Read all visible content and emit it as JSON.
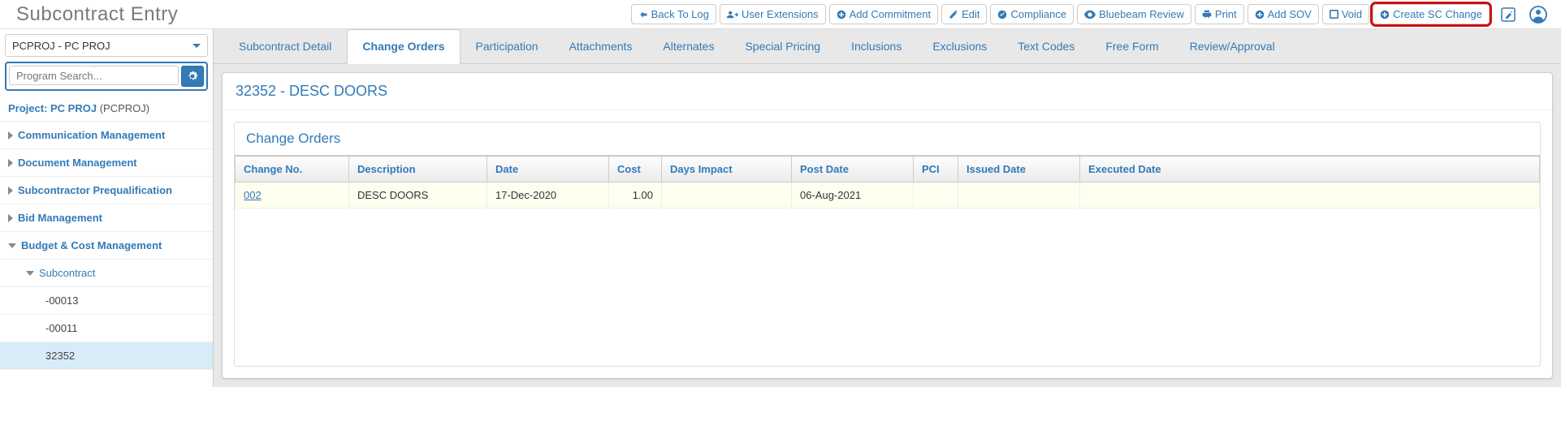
{
  "header": {
    "title": "Subcontract Entry",
    "buttons": {
      "back_to_log": "Back To Log",
      "user_extensions": "User Extensions",
      "add_commitment": "Add Commitment",
      "edit": "Edit",
      "compliance": "Compliance",
      "bluebeam_review": "Bluebeam Review",
      "print": "Print",
      "add_sov": "Add SOV",
      "void": "Void",
      "create_sc_change": "Create SC Change"
    }
  },
  "sidebar": {
    "project_select": "PCPROJ - PC PROJ",
    "search_placeholder": "Program Search...",
    "project_label": "Project: PC PROJ",
    "project_code": "(PCPROJ)",
    "items": [
      {
        "label": "Communication Management"
      },
      {
        "label": "Document Management"
      },
      {
        "label": "Subcontractor Prequalification"
      },
      {
        "label": "Bid Management"
      },
      {
        "label": "Budget & Cost Management"
      }
    ],
    "sub_items": [
      {
        "label": "Subcontract"
      }
    ],
    "leaf_items": [
      {
        "label": "-00013"
      },
      {
        "label": "-00011"
      },
      {
        "label": "32352"
      }
    ]
  },
  "tabs": [
    "Subcontract Detail",
    "Change Orders",
    "Participation",
    "Attachments",
    "Alternates",
    "Special Pricing",
    "Inclusions",
    "Exclusions",
    "Text Codes",
    "Free Form",
    "Review/Approval"
  ],
  "panel_title": "32352 - DESC DOORS",
  "grid": {
    "title": "Change Orders",
    "columns": [
      "Change No.",
      "Description",
      "Date",
      "Cost",
      "Days Impact",
      "Post Date",
      "PCI",
      "Issued Date",
      "Executed Date"
    ],
    "rows": [
      {
        "change_no": "002",
        "description": "DESC DOORS",
        "date": "17-Dec-2020",
        "cost": "1.00",
        "days_impact": "",
        "post_date": "06-Aug-2021",
        "pci": "",
        "issued_date": "",
        "executed_date": ""
      }
    ]
  }
}
